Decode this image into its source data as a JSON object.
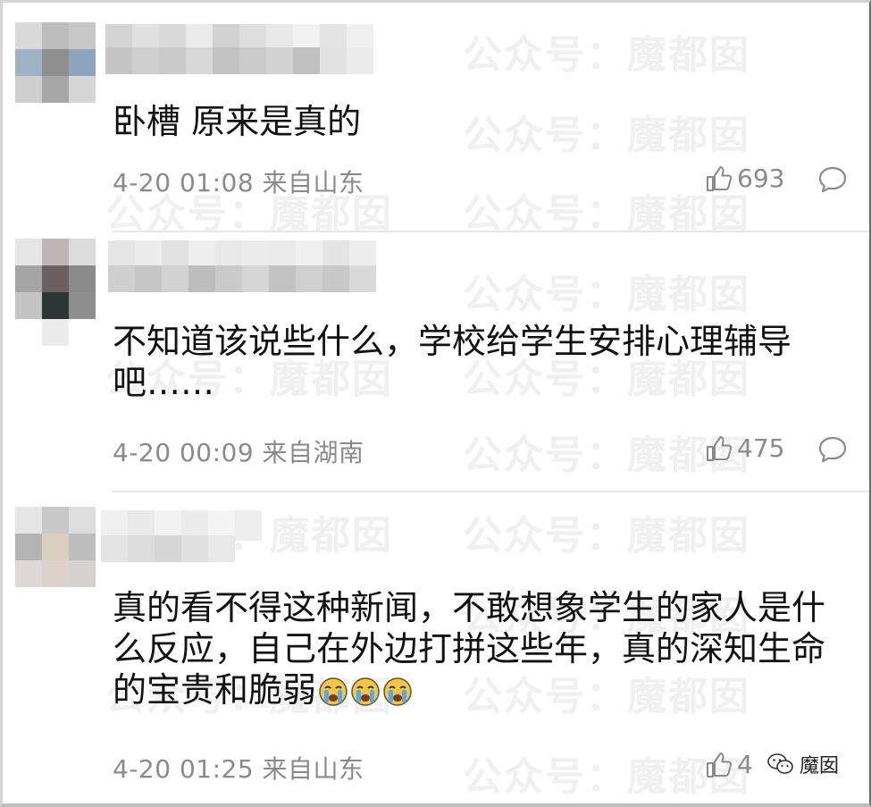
{
  "comments": [
    {
      "text": "卧槽 原来是真的",
      "date": "4-20 01:08",
      "location": "来自山东",
      "likes": "693",
      "emoji_icons": []
    },
    {
      "text": "不知道该说些什么，学校给学生安排心理辅导吧……",
      "date": "4-20 00:09",
      "location": "来自湖南",
      "likes": "475",
      "emoji_icons": []
    },
    {
      "text": "真的看不得这种新闻，不敢想象学生的家人是什么反应，自己在外边打拼这些年，真的深知生命的宝贵和脆弱",
      "date": "4-20 01:25",
      "location": "来自山东",
      "likes": "4",
      "emoji_icons": [
        "crying-face-icon",
        "crying-face-icon",
        "crying-face-icon"
      ]
    }
  ],
  "watermark": "公众号：魔都囡",
  "brand": {
    "label": "魔囡",
    "icon": "wechat-icon"
  },
  "colors": {
    "meta": "#8a8a8a",
    "text": "#111111",
    "divider": "#e6e6e6"
  }
}
